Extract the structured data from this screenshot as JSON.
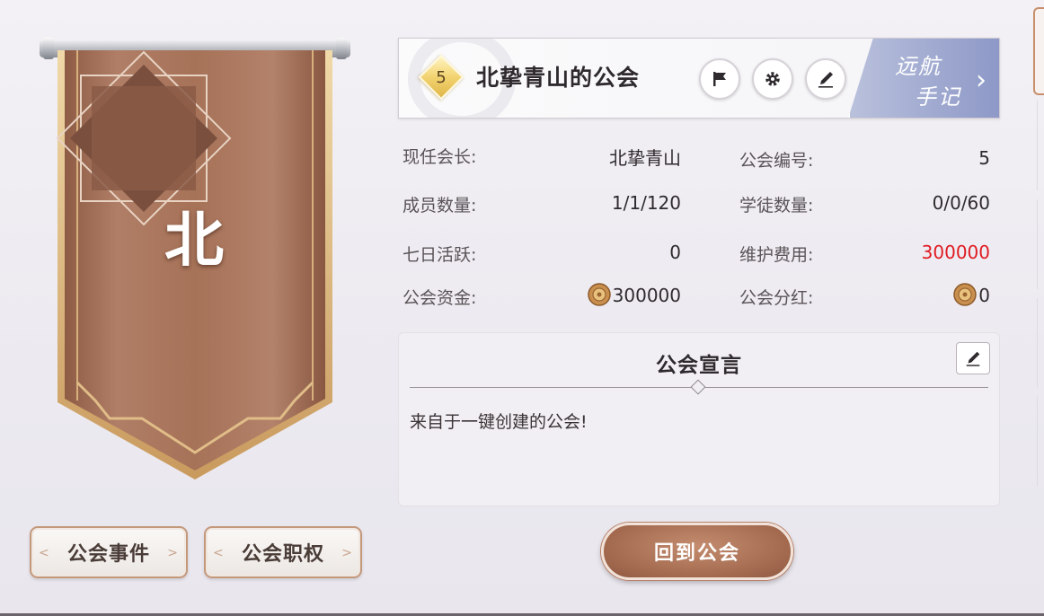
{
  "banner": {
    "emblem_char": "北"
  },
  "header": {
    "level": "5",
    "guild_name": "北挚青山的公会",
    "voyage_line1": "远航",
    "voyage_line2": "手记"
  },
  "info": {
    "president_label": "现任会长:",
    "president_value": "北挚青山",
    "guild_id_label": "公会编号:",
    "guild_id_value": "5",
    "members_label": "成员数量:",
    "members_value": "1/1/120",
    "apprentices_label": "学徒数量:",
    "apprentices_value": "0/0/60",
    "active_label": "七日活跃:",
    "active_value": "0",
    "upkeep_label": "维护费用:",
    "upkeep_value": "300000",
    "funds_label": "公会资金:",
    "funds_value": "300000",
    "dividend_label": "公会分红:",
    "dividend_value": "0"
  },
  "declaration": {
    "title": "公会宣言",
    "text": "来自于一键创建的公会!"
  },
  "buttons": {
    "events": "公会事件",
    "roles": "公会职权",
    "return": "回到公会"
  },
  "colors": {
    "banner": "#a9755c",
    "gold_trim": "#d7b27a",
    "accent_red": "#e01b23",
    "voyage": "#8d98c7"
  },
  "icons": {
    "flag": "flag-icon",
    "gear": "gear-icon",
    "pen": "pen-icon",
    "coin": "coin-icon",
    "chevron": "chevron-right-icon"
  }
}
